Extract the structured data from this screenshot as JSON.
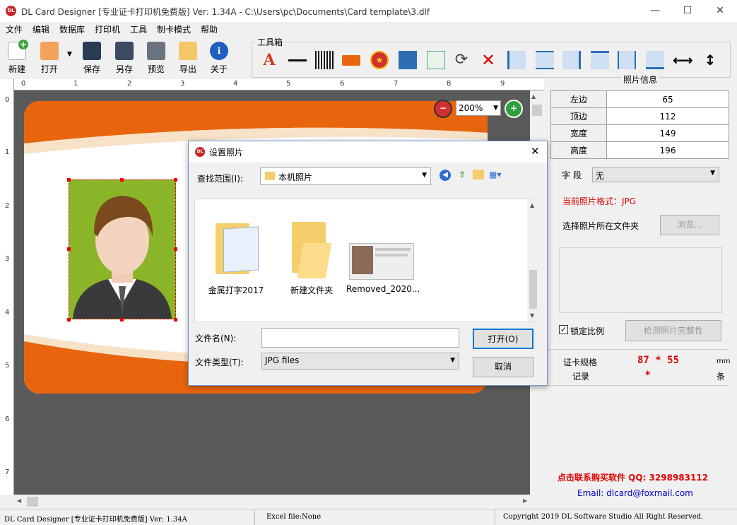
{
  "window": {
    "title": "DL Card Designer [专业证卡打印机免费版] Ver: 1.34A - C:\\Users\\pc\\Documents\\Card template\\3.dlf",
    "logo": "DL",
    "controls": [
      "—",
      "☐",
      "✕"
    ]
  },
  "menu": [
    "文件",
    "编辑",
    "数据库",
    "打印机",
    "工具",
    "制卡模式",
    "帮助"
  ],
  "toolbar": {
    "buttons": [
      "新建",
      "打开",
      "保存",
      "另存",
      "预览",
      "导出",
      "关于"
    ],
    "toolbox_title": "工具箱"
  },
  "zoom": {
    "value": "200%"
  },
  "ruler": {
    "top": [
      "0",
      "1",
      "2",
      "3",
      "4",
      "5",
      "6",
      "7",
      "8",
      "9"
    ],
    "left": [
      "0",
      "1",
      "2",
      "3",
      "4",
      "5",
      "6",
      "7"
    ]
  },
  "right_panel": {
    "section_title": "照片信息",
    "props": [
      {
        "k": "左边",
        "v": "65"
      },
      {
        "k": "顶边",
        "v": "112"
      },
      {
        "k": "宽度",
        "v": "149"
      },
      {
        "k": "高度",
        "v": "196"
      }
    ],
    "field_label": "字  段",
    "field_value": "无",
    "format_label": "当前照片格式：JPG",
    "folder_label": "选择照片所在文件夹",
    "browse": "浏览...",
    "lock_ratio": "锁定比例",
    "check_integrity": "检测照片完整性",
    "spec_label": "证卡规格",
    "spec_value": "87 * 55",
    "spec_unit": "mm",
    "records_label": "记录",
    "records_value": "*",
    "records_unit": "条",
    "contact": "点击联系购买软件 QQ: 3298983112",
    "email": "Email: dlcard@foxmail.com"
  },
  "dialog": {
    "title": "设置照片",
    "look_in_label": "查找范围(I):",
    "look_in_value": "本机照片",
    "files": [
      {
        "name": "金属打字2017"
      },
      {
        "name": "新建文件夹"
      },
      {
        "name": "Removed_2020..."
      }
    ],
    "filename_label": "文件名(N):",
    "filename_value": "",
    "filetype_label": "文件类型(T):",
    "filetype_value": "JPG files",
    "open": "打开(O)",
    "cancel": "取消"
  },
  "status": {
    "left": "DL Card Designer [专业证卡打印机免费版] Ver: 1.34A",
    "mid": "Excel file:None",
    "right": "Copyright 2019 DL Software Studio All Right Reserved."
  },
  "colors": {
    "orange": "#e8650e",
    "photo_bg": "#8ab528",
    "red_text": "#e00000",
    "blue_text": "#0000cc"
  }
}
